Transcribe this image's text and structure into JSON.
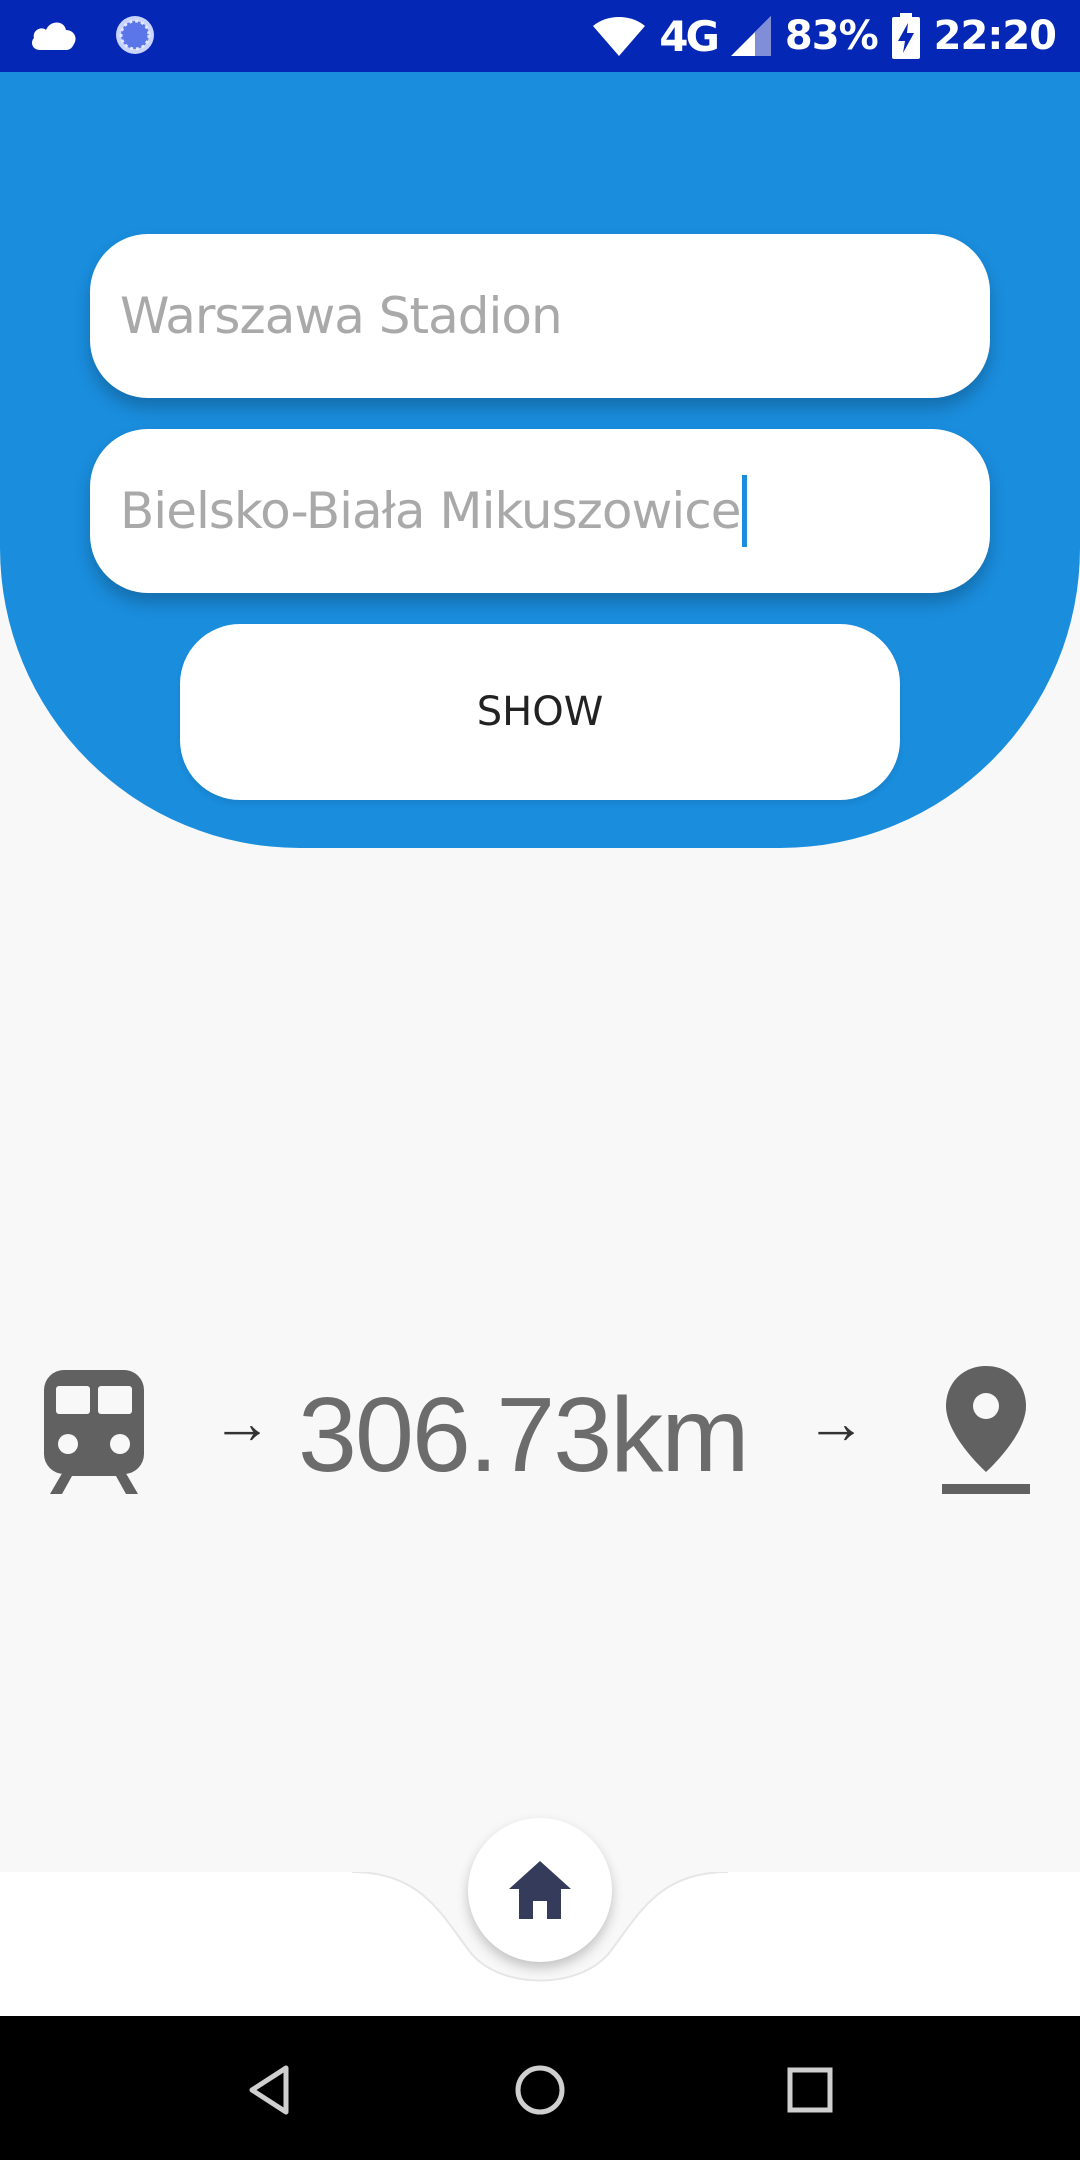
{
  "status_bar": {
    "left_icons": [
      "cloud-icon",
      "loading-circle-icon"
    ],
    "network": "4G",
    "battery": "83%",
    "time": "22:20"
  },
  "form": {
    "from_value": "Warszawa Stadion",
    "to_value": "Bielsko-Biała Mikuszowice",
    "show_label": "SHOW"
  },
  "result": {
    "arrow_left": "→",
    "distance": "306.73km",
    "arrow_right": "→",
    "start_icon": "train-icon",
    "end_icon": "location-pin-icon"
  },
  "bottom_nav": {
    "home_icon": "home-icon"
  },
  "system_nav": {
    "buttons": [
      "back-icon",
      "home-circle-icon",
      "recents-icon"
    ]
  },
  "colors": {
    "status_bar": "#0427b6",
    "header": "#1a8ddd",
    "accent_cursor": "#1a8ddd",
    "icon_gray": "#616161",
    "home_icon": "#353b5a"
  }
}
